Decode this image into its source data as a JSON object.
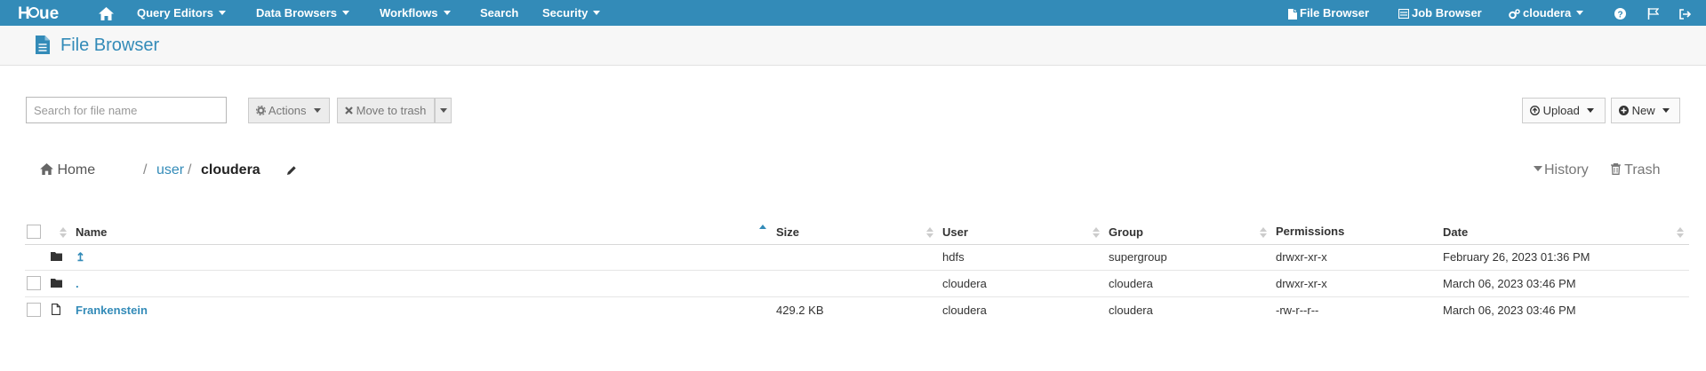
{
  "brand": {
    "logo_text": "HUE",
    "color": "#338bb8"
  },
  "nav": {
    "home_icon": "home-icon",
    "items": [
      {
        "label": "Query Editors"
      },
      {
        "label": "Data Browsers"
      },
      {
        "label": "Workflows"
      },
      {
        "label": "Search"
      },
      {
        "label": "Security"
      }
    ],
    "right": {
      "file_browser": "File Browser",
      "job_browser": "Job Browser",
      "user": "cloudera"
    }
  },
  "app": {
    "title": "File Browser"
  },
  "toolbar": {
    "search_placeholder": "Search for file name",
    "actions_label": "Actions",
    "trash_label": "Move to trash",
    "upload_label": "Upload",
    "new_label": "New"
  },
  "breadcrumb": {
    "home": "Home",
    "sep1": "/",
    "part1": "user",
    "sep2": "/",
    "current": "cloudera",
    "history": "History",
    "trash": "Trash"
  },
  "table": {
    "columns": {
      "name": "Name",
      "size": "Size",
      "user": "User",
      "group": "Group",
      "permissions": "Permissions",
      "date": "Date"
    },
    "rows": [
      {
        "type": "folder",
        "name": "↥",
        "size": "",
        "user": "hdfs",
        "group": "supergroup",
        "permissions": "drwxr-xr-x",
        "date": "February 26, 2023 01:36 PM"
      },
      {
        "type": "folder",
        "name": ".",
        "size": "",
        "user": "cloudera",
        "group": "cloudera",
        "permissions": "drwxr-xr-x",
        "date": "March 06, 2023 03:46 PM"
      },
      {
        "type": "file",
        "name": "Frankenstein",
        "size": "429.2 KB",
        "user": "cloudera",
        "group": "cloudera",
        "permissions": "-rw-r--r--",
        "date": "March 06, 2023 03:46 PM"
      }
    ]
  }
}
